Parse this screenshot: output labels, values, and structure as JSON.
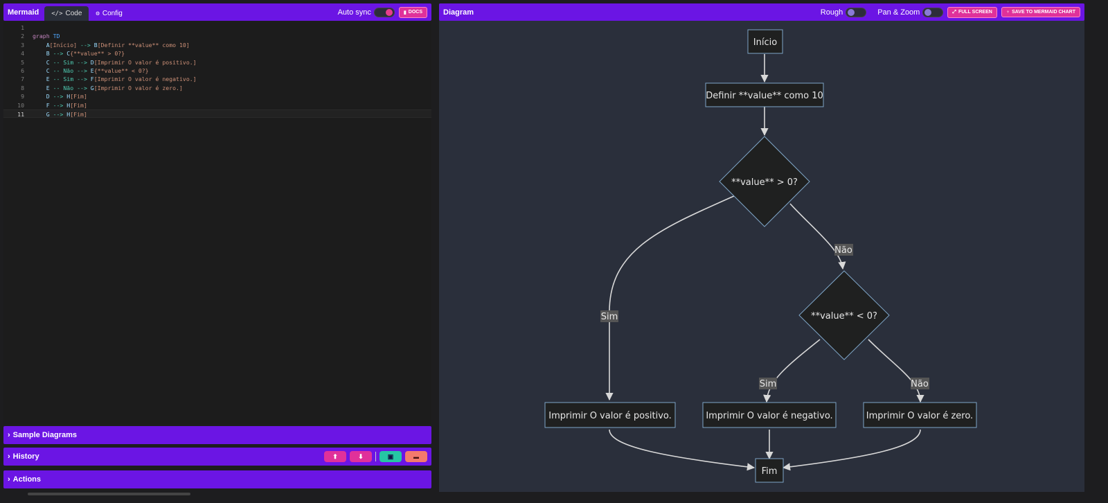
{
  "editor": {
    "brand": "Mermaid",
    "tabs": [
      {
        "label": "Code",
        "icon": "code-icon",
        "active": true
      },
      {
        "label": "Config",
        "icon": "gears-icon",
        "active": false
      }
    ],
    "auto_sync_label": "Auto sync",
    "auto_sync_on": true,
    "docs_label": "DOCS",
    "current_line": 11,
    "lines": [
      {
        "n": "1",
        "segments": []
      },
      {
        "n": "2",
        "segments": [
          {
            "t": "graph ",
            "c": "kw"
          },
          {
            "t": "TD",
            "c": "kw2"
          }
        ]
      },
      {
        "n": "3",
        "segments": [
          {
            "t": "    A",
            "c": "node"
          },
          {
            "t": "[Início] ",
            "c": "txt"
          },
          {
            "t": "-->",
            "c": "arrow"
          },
          {
            "t": " B",
            "c": "node"
          },
          {
            "t": "[Definir **value** como 10]",
            "c": "txt"
          }
        ]
      },
      {
        "n": "4",
        "segments": [
          {
            "t": "    B ",
            "c": "node"
          },
          {
            "t": "-->",
            "c": "arrow"
          },
          {
            "t": " C",
            "c": "node"
          },
          {
            "t": "{**value** > 0?}",
            "c": "txt"
          }
        ]
      },
      {
        "n": "5",
        "segments": [
          {
            "t": "    C ",
            "c": "node"
          },
          {
            "t": "-- Sim -->",
            "c": "arrow"
          },
          {
            "t": " D",
            "c": "node"
          },
          {
            "t": "[Imprimir O valor é positivo.]",
            "c": "txt"
          }
        ]
      },
      {
        "n": "6",
        "segments": [
          {
            "t": "    C ",
            "c": "node"
          },
          {
            "t": "-- Não -->",
            "c": "arrow"
          },
          {
            "t": " E",
            "c": "node"
          },
          {
            "t": "{**value** < 0?}",
            "c": "txt"
          }
        ]
      },
      {
        "n": "7",
        "segments": [
          {
            "t": "    E ",
            "c": "node"
          },
          {
            "t": "-- Sim -->",
            "c": "arrow"
          },
          {
            "t": " F",
            "c": "node"
          },
          {
            "t": "[Imprimir O valor é negativo.]",
            "c": "txt"
          }
        ]
      },
      {
        "n": "8",
        "segments": [
          {
            "t": "    E ",
            "c": "node"
          },
          {
            "t": "-- Não -->",
            "c": "arrow"
          },
          {
            "t": " G",
            "c": "node"
          },
          {
            "t": "[Imprimir O valor é zero.]",
            "c": "txt"
          }
        ]
      },
      {
        "n": "9",
        "segments": [
          {
            "t": "    D ",
            "c": "node"
          },
          {
            "t": "-->",
            "c": "arrow"
          },
          {
            "t": " H",
            "c": "node"
          },
          {
            "t": "[Fim]",
            "c": "txt"
          }
        ]
      },
      {
        "n": "10",
        "segments": [
          {
            "t": "    F ",
            "c": "node"
          },
          {
            "t": "-->",
            "c": "arrow"
          },
          {
            "t": " H",
            "c": "node"
          },
          {
            "t": "[Fim]",
            "c": "txt"
          }
        ]
      },
      {
        "n": "11",
        "segments": [
          {
            "t": "    G ",
            "c": "node"
          },
          {
            "t": "-->",
            "c": "arrow"
          },
          {
            "t": " H",
            "c": "node"
          },
          {
            "t": "[Fim]",
            "c": "txt"
          }
        ]
      }
    ]
  },
  "sections": {
    "sample_diagrams": "Sample Diagrams",
    "history": "History",
    "actions": "Actions",
    "history_buttons": [
      {
        "name": "upload-button",
        "icon": "upload-icon",
        "glyph": "⬆"
      },
      {
        "name": "download-button",
        "icon": "download-icon",
        "glyph": "⬇"
      },
      {
        "name": "save-history-button",
        "icon": "save-icon",
        "glyph": "▣"
      },
      {
        "name": "delete-history-button",
        "icon": "trash-icon",
        "glyph": "🗑"
      }
    ]
  },
  "diagram": {
    "title": "Diagram",
    "rough_label": "Rough",
    "rough_on": false,
    "panzoom_label": "Pan & Zoom",
    "panzoom_on": false,
    "fullscreen_label": "FULL SCREEN",
    "save_label": "SAVE TO MERMAID CHART",
    "nodes": {
      "A": "Início",
      "B": "Definir **value** como 10",
      "C": "**value** > 0?",
      "D": "Imprimir O valor é positivo.",
      "E": "**value** < 0?",
      "F": "Imprimir O valor é negativo.",
      "G": "Imprimir O valor é zero.",
      "H": "Fim"
    },
    "edge_labels": {
      "C_D": "Sim",
      "C_E": "Não",
      "E_F": "Sim",
      "E_G": "Não"
    }
  },
  "colors": {
    "accent": "#6b15e4",
    "pink": "#e0319a",
    "diagram_bg": "#2a2f3b",
    "node_fill": "#1f2020",
    "node_stroke": "#7fa6c8"
  }
}
